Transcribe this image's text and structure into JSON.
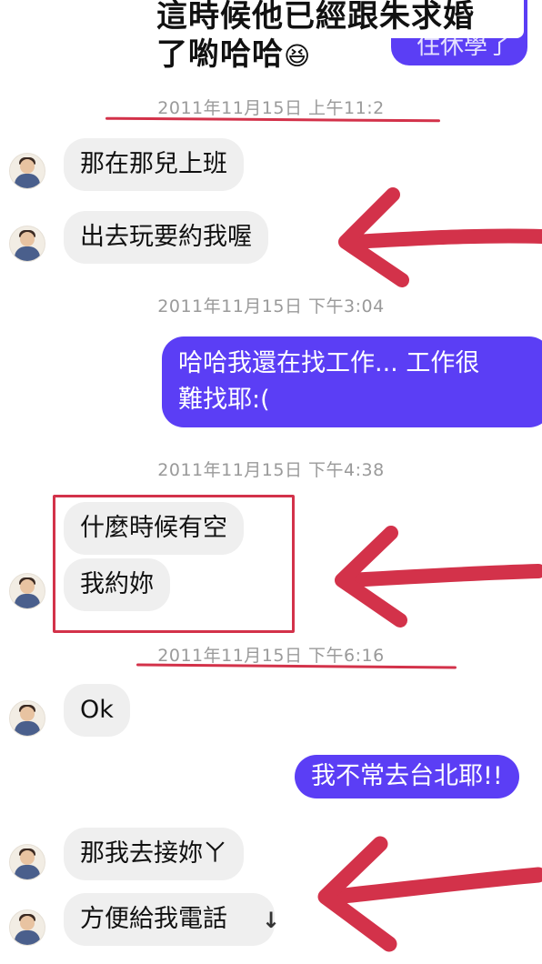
{
  "overlay": {
    "caption_line1": "這時候他已經跟朱求婚",
    "caption_line2": "了喲哈哈",
    "caption_emoji": "😆",
    "partial_bubble_text": "住休學了"
  },
  "chat": {
    "timestamps": {
      "t1": "2011年11月15日 上午11:2",
      "t2": "2011年11月15日 下午3:04",
      "t3": "2011年11月15日 下午4:38",
      "t4": "2011年11月15日 下午6:16"
    },
    "messages": {
      "m1": "那在那兒上班",
      "m2": "出去玩要約我喔",
      "m3_line1": "哈哈我還在找工作... 工作很",
      "m3_line2": "難找耶:(",
      "m4": "什麼時候有空",
      "m5": "我約妳",
      "m6": "Ok",
      "m7": "我不常去台北耶!!",
      "m8": "那我去接妳ㄚ",
      "m9": "方便給我電話"
    },
    "scroll_down_icon": "↓"
  },
  "colors": {
    "accent": "#5b3ef5",
    "annotation_red": "#d3324a",
    "incoming_bubble": "#efefef"
  }
}
